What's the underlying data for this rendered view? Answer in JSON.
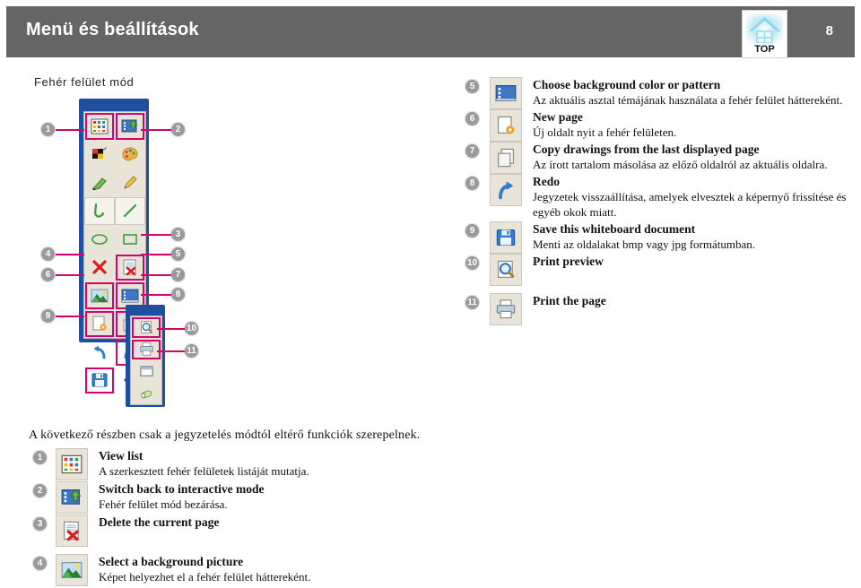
{
  "header": {
    "title": "Menü és beállítások",
    "page_number": "8",
    "logo_text": "TOP",
    "bar_color": "#656565"
  },
  "mode_label": "Fehér felület mód",
  "toolbar": {
    "main_icons": [
      {
        "name": "view-list-icon",
        "callout": "1",
        "highlighted": true
      },
      {
        "name": "switch-interactive-mode-icon",
        "callout": "2",
        "highlighted": true
      },
      {
        "name": "color-swatch-icon",
        "callout": "",
        "highlighted": false
      },
      {
        "name": "palette-icon",
        "callout": "",
        "highlighted": false
      },
      {
        "name": "highlighter-icon",
        "callout": "",
        "highlighted": false
      },
      {
        "name": "pencil-icon",
        "callout": "",
        "highlighted": false
      },
      {
        "name": "freehand-curve-icon",
        "callout": "",
        "highlighted": false
      },
      {
        "name": "straight-line-icon",
        "callout": "",
        "highlighted": false
      },
      {
        "name": "ellipse-icon",
        "callout": "",
        "highlighted": false
      },
      {
        "name": "rectangle-icon",
        "callout": "",
        "highlighted": false
      },
      {
        "name": "clear-all-icon",
        "callout": "",
        "highlighted": false
      },
      {
        "name": "delete-current-page-icon",
        "callout": "3",
        "highlighted": true
      },
      {
        "name": "background-picture-icon",
        "callout": "4",
        "highlighted": true
      },
      {
        "name": "background-color-pattern-icon",
        "callout": "5",
        "highlighted": true
      },
      {
        "name": "new-page-icon",
        "callout": "6",
        "highlighted": true
      },
      {
        "name": "copy-drawings-icon",
        "callout": "7",
        "highlighted": true
      },
      {
        "name": "undo-icon",
        "callout": "",
        "highlighted": false
      },
      {
        "name": "redo-icon",
        "callout": "8",
        "highlighted": true
      },
      {
        "name": "save-document-icon",
        "callout": "9",
        "highlighted": true
      },
      {
        "name": "more-options-icon",
        "callout": "",
        "highlighted": false
      }
    ],
    "side_icons": [
      {
        "name": "print-preview-icon",
        "callout": "10",
        "highlighted": true
      },
      {
        "name": "print-page-icon",
        "callout": "11",
        "highlighted": true
      },
      {
        "name": "window-icon",
        "callout": "",
        "highlighted": false
      },
      {
        "name": "eraser-icon",
        "callout": "",
        "highlighted": false
      }
    ],
    "callout_line_color": "#d6006f",
    "callout_badge_color": "#9a9a9a",
    "frame_color": "#1f4f9e"
  },
  "right_list": [
    {
      "num": "5",
      "icon": "background-color-pattern-icon",
      "title": "Choose background color or pattern",
      "desc": "Az aktuális asztal témájának használata a fehér felület háttereként."
    },
    {
      "num": "6",
      "icon": "new-page-icon",
      "title": "New page",
      "desc": "Új oldalt nyit a fehér felületen."
    },
    {
      "num": "7",
      "icon": "copy-drawings-icon",
      "title": "Copy drawings from the last displayed page",
      "desc": "Az írott tartalom másolása az előző oldalról az aktuális oldalra."
    },
    {
      "num": "8",
      "icon": "redo-icon",
      "title": "Redo",
      "desc": "Jegyzetek visszaállítása, amelyek elvesztek a képernyő frissítése és egyéb okok miatt."
    },
    {
      "num": "9",
      "icon": "save-document-icon",
      "title": "Save this whiteboard document",
      "desc": "Menti az oldalakat bmp vagy jpg formátumban."
    },
    {
      "num": "10",
      "icon": "print-preview-icon",
      "title": "Print preview",
      "desc": ""
    },
    {
      "num": "11",
      "icon": "print-page-icon",
      "title": "Print the page",
      "desc": ""
    }
  ],
  "bottom_note": "A következő részben csak a jegyzetelés módtól eltérő funkciók szerepelnek.",
  "bottom_list": [
    {
      "num": "1",
      "icon": "view-list-icon",
      "title": "View list",
      "desc": "A szerkesztett fehér felületek listáját mutatja."
    },
    {
      "num": "2",
      "icon": "switch-interactive-mode-icon",
      "title": "Switch back to interactive mode",
      "desc": "Fehér felület mód bezárása."
    },
    {
      "num": "3",
      "icon": "delete-current-page-icon",
      "title": "Delete the current page",
      "desc": ""
    },
    {
      "num": "4",
      "icon": "background-picture-icon",
      "title": "Select a background picture",
      "desc": "Képet helyezhet el a fehér felület háttereként."
    }
  ]
}
